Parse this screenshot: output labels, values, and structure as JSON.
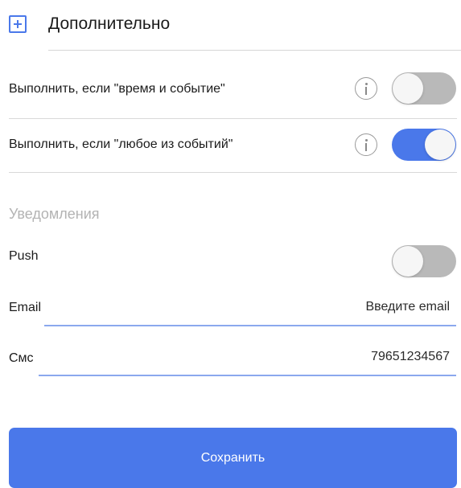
{
  "header": {
    "title": "Дополнительно",
    "expand_icon": "plus-square-icon"
  },
  "options": [
    {
      "label": "Выполнить, если \"время и событие\"",
      "enabled": false,
      "info_icon": "info-icon"
    },
    {
      "label": "Выполнить, если \"любое из событий\"",
      "enabled": true,
      "info_icon": "info-icon"
    }
  ],
  "notifications": {
    "title": "Уведомления",
    "push": {
      "label": "Push",
      "enabled": false
    },
    "email": {
      "label": "Email",
      "placeholder": "Введите email",
      "value": ""
    },
    "sms": {
      "label": "Смс",
      "value": "79651234567"
    }
  },
  "actions": {
    "save_label": "Сохранить"
  },
  "colors": {
    "accent": "#4a78ea",
    "toggle_off": "#b9b9b9",
    "section_title": "#b3b3b3",
    "divider": "#d9d9d9"
  }
}
